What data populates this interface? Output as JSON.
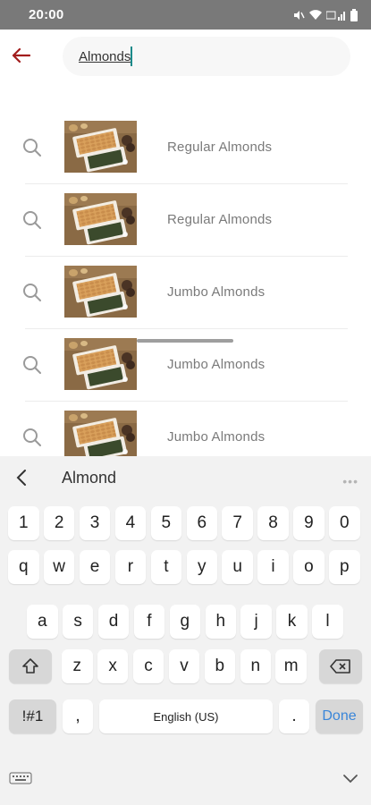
{
  "status_bar": {
    "time": "20:00",
    "icons": [
      "mute-icon",
      "wifi-icon",
      "lte-signal-icon",
      "battery-icon"
    ]
  },
  "search": {
    "query": "Almonds",
    "back_icon": "back-arrow-icon"
  },
  "results": [
    {
      "label": "Regular Almonds",
      "icon": "search-icon",
      "image": "almond-product-thumbnail"
    },
    {
      "label": "Regular Almonds",
      "icon": "search-icon",
      "image": "almond-product-thumbnail"
    },
    {
      "label": "Jumbo Almonds",
      "icon": "search-icon",
      "image": "almond-product-thumbnail"
    },
    {
      "label": "Jumbo Almonds",
      "icon": "search-icon",
      "image": "almond-product-thumbnail"
    },
    {
      "label": "Jumbo Almonds",
      "icon": "search-icon",
      "image": "almond-product-thumbnail"
    }
  ],
  "keyboard": {
    "suggestion": "Almond",
    "more_label": "•••",
    "row_numbers": [
      "1",
      "2",
      "3",
      "4",
      "5",
      "6",
      "7",
      "8",
      "9",
      "0"
    ],
    "row_top": [
      "q",
      "w",
      "e",
      "r",
      "t",
      "y",
      "u",
      "i",
      "o",
      "p"
    ],
    "row_mid": [
      "a",
      "s",
      "d",
      "f",
      "g",
      "h",
      "j",
      "k",
      "l"
    ],
    "row_low": [
      "z",
      "x",
      "c",
      "v",
      "b",
      "n",
      "m"
    ],
    "symbols_label": "!#1",
    "comma_label": ",",
    "space_label": "English (US)",
    "period_label": ".",
    "done_label": "Done"
  },
  "colors": {
    "accent": "#a21d1d",
    "done": "#3a86d9",
    "status_bar": "#797979"
  }
}
